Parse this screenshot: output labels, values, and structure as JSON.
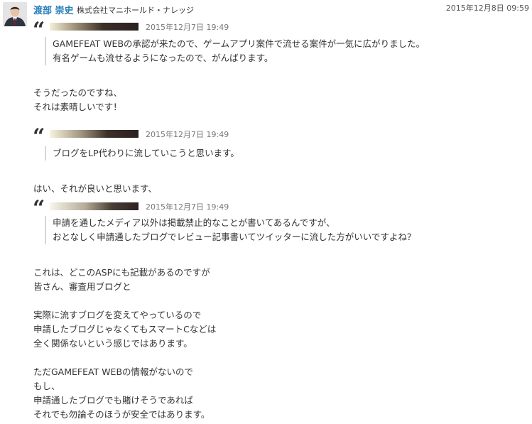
{
  "post": {
    "author": {
      "name": "渡部 崇史",
      "company": "株式会社マニホールド・ナレッジ"
    },
    "timestamp": "2015年12月8日 09:59",
    "quotes": [
      {
        "time": "2015年12月7日 19:49",
        "lines": [
          "GAMEFEAT WEBの承認が来たので、ゲームアプリ案件で流せる案件が一気に広がりました。",
          "有名ゲームも流せるようになったので、がんばります。"
        ]
      },
      {
        "time": "2015年12月7日 19:49",
        "lines": [
          "ブログをLP代わりに流していこうと思います。"
        ]
      },
      {
        "time": "2015年12月7日 19:49",
        "lines": [
          "申請を通したメディア以外は掲載禁止的なことが書いてあるんですが、",
          "おとなしく申請通したブログでレビュー記事書いてツイッターに流した方がいいですよね？"
        ]
      }
    ],
    "replies": [
      [
        "そうだったのですね、",
        "それは素晴しいです！"
      ],
      [
        "はい、それが良いと思います、"
      ],
      [
        "これは、どこのASPにも記載があるのですが",
        "皆さん、審査用ブログと",
        "",
        "実際に流すブログを変えてやっているので",
        "申請したブログじゃなくてもスマートCなどは",
        "全く関係ないという感じではあります。",
        "",
        "ただGAMEFEAT WEBの情報がないので",
        "もし、",
        "申請通したブログでも賭けそうであれば",
        "それでも勿論そのほうが安全ではあります。"
      ]
    ],
    "icons": {
      "quote": "quote-icon",
      "avatar": "user-avatar"
    }
  }
}
